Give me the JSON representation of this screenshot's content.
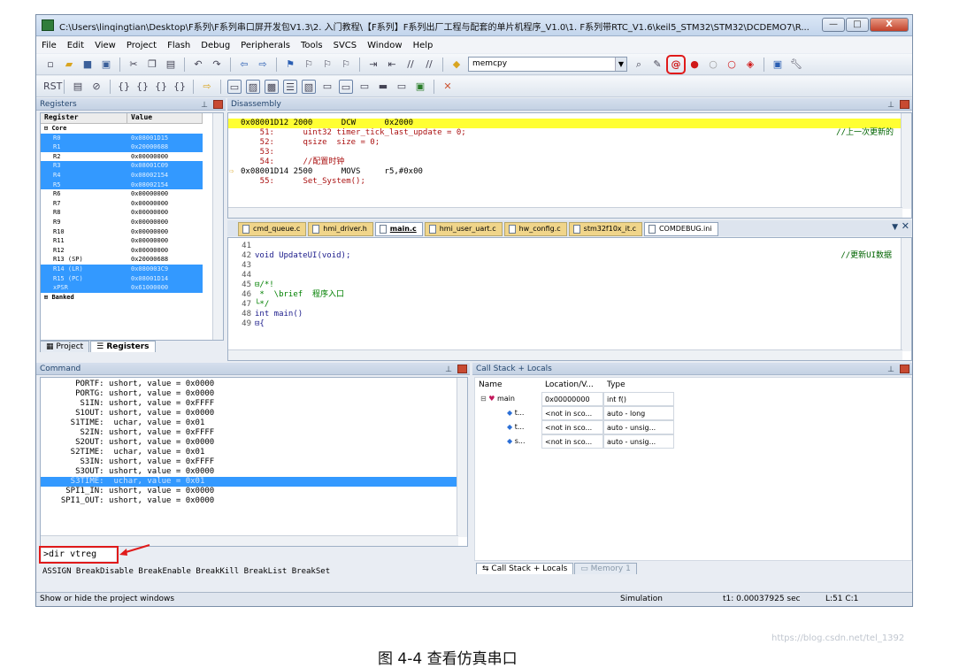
{
  "window": {
    "title": "C:\\Users\\linqingtian\\Desktop\\F系列\\F系列串口屏开发包V1.3\\2. 入门教程\\【F系列】F系列出厂工程与配套的单片机程序_V1.0\\1. F系列带RTC_V1.6\\keil5_STM32\\STM32\\DCDEMO7\\R...",
    "buttons": {
      "minimize": "—",
      "maximize": "□",
      "close": "X"
    }
  },
  "menu": [
    "File",
    "Edit",
    "View",
    "Project",
    "Flash",
    "Debug",
    "Peripherals",
    "Tools",
    "SVCS",
    "Window",
    "Help"
  ],
  "toolbar": {
    "search_combo": "memcpy"
  },
  "registers": {
    "header": "Registers",
    "col_register": "Register",
    "col_value": "Value",
    "core_label": "Core",
    "rows": [
      {
        "name": "R0",
        "value": "0x08001D15",
        "sel": true
      },
      {
        "name": "R1",
        "value": "0x20000688",
        "sel": true
      },
      {
        "name": "R2",
        "value": "0x00000000",
        "sel": false
      },
      {
        "name": "R3",
        "value": "0x08001C09",
        "sel": true
      },
      {
        "name": "R4",
        "value": "0x08002154",
        "sel": true
      },
      {
        "name": "R5",
        "value": "0x08002154",
        "sel": true
      },
      {
        "name": "R6",
        "value": "0x00000000",
        "sel": false
      },
      {
        "name": "R7",
        "value": "0x00000000",
        "sel": false
      },
      {
        "name": "R8",
        "value": "0x00000000",
        "sel": false
      },
      {
        "name": "R9",
        "value": "0x00000000",
        "sel": false
      },
      {
        "name": "R10",
        "value": "0x00000000",
        "sel": false
      },
      {
        "name": "R11",
        "value": "0x00000000",
        "sel": false
      },
      {
        "name": "R12",
        "value": "0x00000000",
        "sel": false
      },
      {
        "name": "R13 (SP)",
        "value": "0x20000688",
        "sel": false
      },
      {
        "name": "R14 (LR)",
        "value": "0x080003C9",
        "sel": true
      },
      {
        "name": "R15 (PC)",
        "value": "0x08001D14",
        "sel": true
      },
      {
        "name": "xPSR",
        "value": "0x61000000",
        "sel": true
      }
    ],
    "banked_label": "Banked",
    "tabs": {
      "project": "Project",
      "registers": "Registers"
    }
  },
  "disassembly": {
    "header": "Disassembly",
    "lines": [
      {
        "text": "0x08001D12 2000      DCW      0x2000",
        "comment": "",
        "cur": true
      },
      {
        "text": "    51:      uint32 timer_tick_last_update = 0;",
        "comment": "//上一次更新的",
        "cur": false
      },
      {
        "text": "    52:      qsize  size = 0;",
        "comment": "",
        "cur": false
      },
      {
        "text": "    53:",
        "comment": "",
        "cur": false
      },
      {
        "text": "    54:      //配置时钟",
        "comment": "",
        "cur": false
      },
      {
        "text": "0x08001D14 2500      MOVS     r5,#0x00",
        "comment": "",
        "cur": false
      },
      {
        "text": "    55:      Set_System();",
        "comment": "",
        "cur": false
      }
    ]
  },
  "editor_tabs": [
    {
      "label": "cmd_queue.c",
      "kind": "tab"
    },
    {
      "label": "hmi_driver.h",
      "kind": "tab"
    },
    {
      "label": "main.c",
      "kind": "active"
    },
    {
      "label": "hmi_user_uart.c",
      "kind": "tab"
    },
    {
      "label": "hw_config.c",
      "kind": "tab"
    },
    {
      "label": "stm32f10x_it.c",
      "kind": "tab"
    },
    {
      "label": "COMDEBUG.ini",
      "kind": "plain"
    }
  ],
  "editor": {
    "lines": [
      {
        "num": "41",
        "text": "",
        "comment": ""
      },
      {
        "num": "42",
        "text": "void UpdateUI(void);",
        "comment": "//更新UI数据"
      },
      {
        "num": "43",
        "text": "",
        "comment": ""
      },
      {
        "num": "44",
        "text": "",
        "comment": ""
      },
      {
        "num": "45",
        "text": "⊟/*!",
        "comment": ""
      },
      {
        "num": "46",
        "text": " *  \\brief  程序入口",
        "comment": ""
      },
      {
        "num": "47",
        "text": "└*/",
        "comment": ""
      },
      {
        "num": "48",
        "text": "int main()",
        "comment": ""
      },
      {
        "num": "49",
        "text": "⊟{",
        "comment": ""
      }
    ]
  },
  "command": {
    "header": "Command",
    "lines": [
      {
        "text": "     PORTF: ushort, value = 0x0000",
        "sel": false
      },
      {
        "text": "     PORTG: ushort, value = 0x0000",
        "sel": false
      },
      {
        "text": "      S1IN: ushort, value = 0xFFFF",
        "sel": false
      },
      {
        "text": "     S1OUT: ushort, value = 0x0000",
        "sel": false
      },
      {
        "text": "    S1TIME:  uchar, value = 0x01",
        "sel": false
      },
      {
        "text": "      S2IN: ushort, value = 0xFFFF",
        "sel": false
      },
      {
        "text": "     S2OUT: ushort, value = 0x0000",
        "sel": false
      },
      {
        "text": "    S2TIME:  uchar, value = 0x01",
        "sel": false
      },
      {
        "text": "      S3IN: ushort, value = 0xFFFF",
        "sel": false
      },
      {
        "text": "     S3OUT: ushort, value = 0x0000",
        "sel": false
      },
      {
        "text": "    S3TIME:  uchar, value = 0x01",
        "sel": true
      },
      {
        "text": "   SPI1_IN: ushort, value = 0x0000",
        "sel": false
      },
      {
        "text": "  SPI1_OUT: ushort, value = 0x0000",
        "sel": false
      }
    ],
    "input": ">dir vtreg",
    "hint": "ASSIGN BreakDisable BreakEnable BreakKill BreakList BreakSet"
  },
  "callstack": {
    "header": "Call Stack + Locals",
    "columns": [
      "Name",
      "Location/V...",
      "Type"
    ],
    "rows": [
      {
        "name": "main",
        "loc": "0x00000000",
        "type": "int f()",
        "level": 0
      },
      {
        "name": "t...",
        "loc": "<not in sco...",
        "type": "auto - long",
        "level": 1
      },
      {
        "name": "t...",
        "loc": "<not in sco...",
        "type": "auto - unsig...",
        "level": 1
      },
      {
        "name": "s...",
        "loc": "<not in sco...",
        "type": "auto - unsig...",
        "level": 1
      }
    ],
    "tabs": {
      "callstack": "Call Stack + Locals",
      "memory": "Memory 1"
    }
  },
  "status": {
    "left": "Show or hide the project windows",
    "mode": "Simulation",
    "time": "t1: 0.00037925 sec",
    "pos": "L:51 C:1"
  },
  "caption": "图 4-4 查看仿真串口",
  "watermark": "https://blog.csdn.net/tel_1392",
  "colors": {
    "highlight_red": "#e01a1a",
    "selection_blue": "#3399ff",
    "current_line_yellow": "#ffff33"
  }
}
